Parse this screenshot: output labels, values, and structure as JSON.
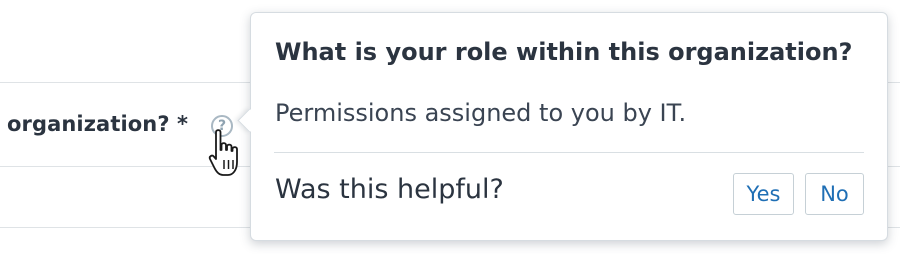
{
  "form": {
    "field_label": "organization? *",
    "help_icon": "question-circle-icon"
  },
  "cursor": {
    "icon": "hand-pointer-cursor"
  },
  "popover": {
    "title": "What is your role within this organization?",
    "body": "Permissions assigned to you by IT.",
    "feedback_question": "Was this helpful?",
    "yes_label": "Yes",
    "no_label": "No",
    "accent_color": "#1f6fb5"
  }
}
